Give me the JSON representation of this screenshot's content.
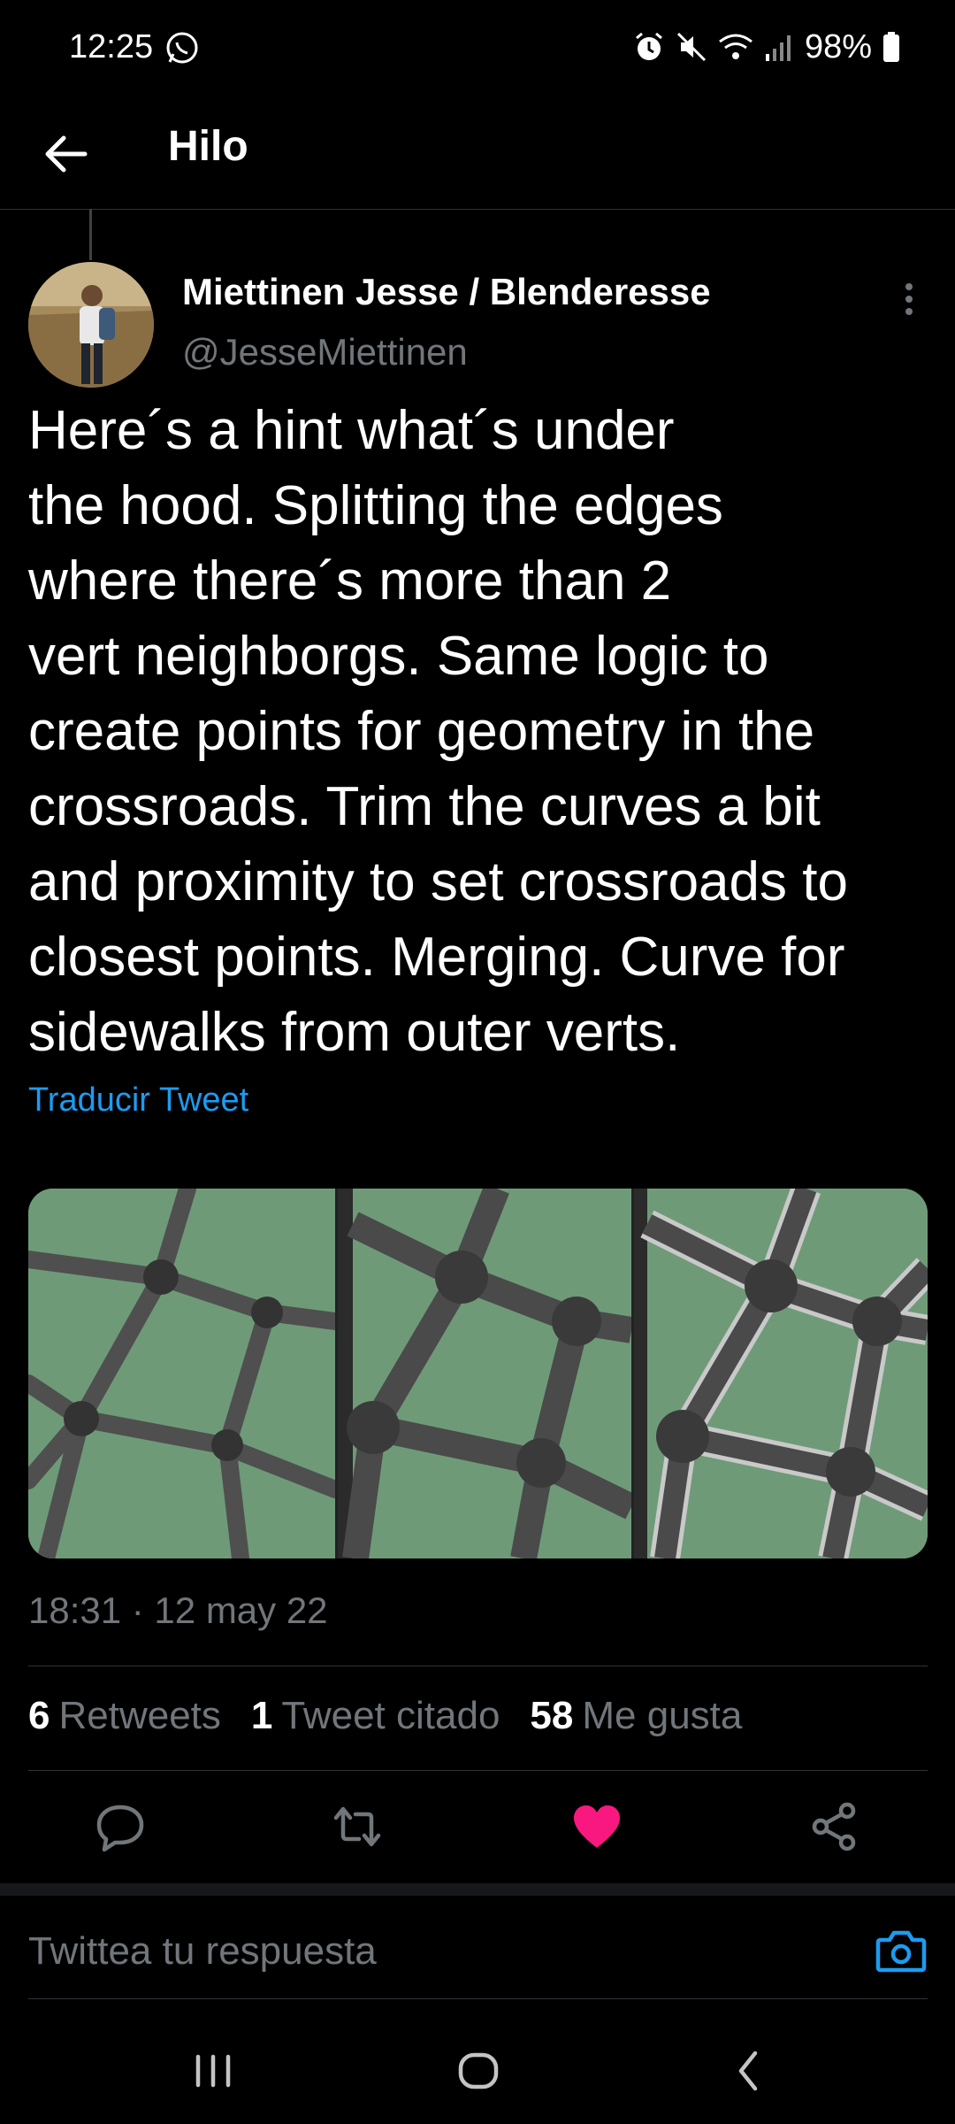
{
  "status_bar": {
    "time": "12:25",
    "battery": "98%",
    "icons": [
      "whatsapp-icon",
      "alarm-icon",
      "mute-icon",
      "wifi-icon",
      "signal-icon",
      "battery-icon"
    ]
  },
  "app_bar": {
    "title": "Hilo",
    "back_icon": "arrow-left-icon"
  },
  "tweet": {
    "author_name": "Miettinen Jesse / Blenderesse",
    "author_handle": "@JesseMiettinen",
    "text": "Here´s a hint what´s under\nthe hood. Splitting the edges\nwhere there´s more than 2\nvert neighborgs. Same logic to\ncreate points for geometry in the\ncrossroads. Trim the curves a bit\nand proximity to set crossroads to\nclosest points. Merging. Curve for\nsidewalks from outer verts.",
    "translate_label": "Traducir Tweet",
    "timestamp": "18:31 · 12 may 22",
    "stats": {
      "retweets_count": "6",
      "retweets_label": "Retweets",
      "quotes_count": "1",
      "quotes_label": "Tweet citado",
      "likes_count": "58",
      "likes_label": "Me gusta"
    }
  },
  "reply": {
    "placeholder": "Twittea tu respuesta"
  },
  "colors": {
    "accent": "#1d9bf0",
    "like": "#f91880",
    "background": "#000000",
    "map_green": "#6f9a78"
  }
}
